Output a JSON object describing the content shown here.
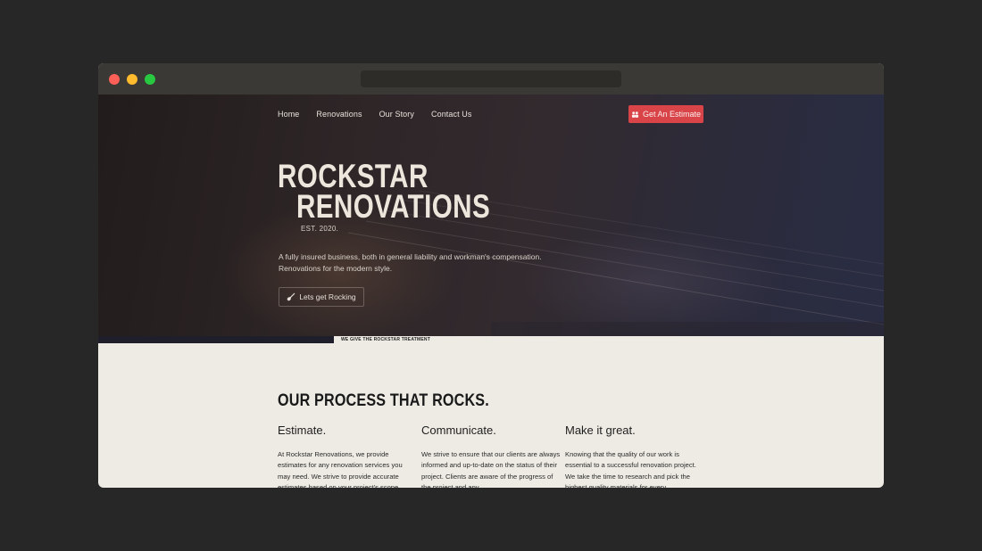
{
  "nav": {
    "items": [
      "Home",
      "Renovations",
      "Our Story",
      "Contact Us"
    ],
    "cta_label": "Get An Estimate"
  },
  "hero": {
    "title_line1": "ROCKSTAR",
    "title_line2": "RENOVATIONS",
    "established": "EST. 2020.",
    "tagline_line1": "A fully insured business, both in general liability and workman's compensation.",
    "tagline_line2": "Renovations for the modern style.",
    "button_label": "Lets get Rocking"
  },
  "banner": {
    "label": "WE GIVE THE ROCKSTAR TREATMENT"
  },
  "process": {
    "title": "OUR PROCESS THAT ROCKS.",
    "columns": [
      {
        "heading": "Estimate.",
        "text": "At Rockstar Renovations, we provide estimates for any renovation services you may need. We strive to provide accurate estimates based on your project's scope."
      },
      {
        "heading": "Communicate.",
        "text": "We strive to ensure that our clients are always informed and up-to-date on the status of their project. Clients are aware of the progress of the project and any"
      },
      {
        "heading": "Make it great.",
        "text": "Knowing that the quality of our work is essential to a successful renovation project. We take the time to research and pick the highest quality materials for every"
      }
    ]
  },
  "colors": {
    "accent": "#d94449",
    "background": "#272727",
    "page": "#eeebe4",
    "hero_dark": "#221c1c"
  }
}
